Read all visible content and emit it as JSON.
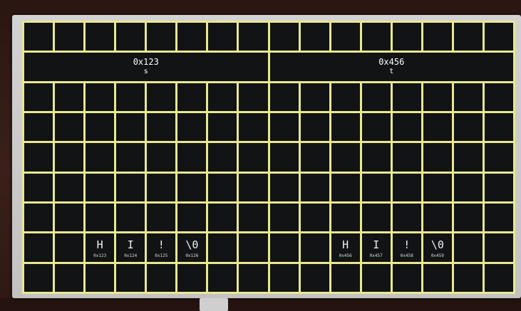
{
  "memory": {
    "pointers": [
      {
        "address": "0x123",
        "name": "s"
      },
      {
        "address": "0x456",
        "name": "t"
      }
    ],
    "strings": [
      {
        "chars": [
          "H",
          "I",
          "!",
          "\\0"
        ],
        "addresses": [
          "0x123",
          "0x124",
          "0x125",
          "0x126"
        ]
      },
      {
        "chars": [
          "H",
          "I",
          "!",
          "\\0"
        ],
        "addresses": [
          "0x456",
          "0x457",
          "0x458",
          "0x459"
        ]
      }
    ]
  },
  "colors": {
    "grid_line": "#e9e890",
    "cell": "#111314",
    "text": "#f2f2f2"
  }
}
